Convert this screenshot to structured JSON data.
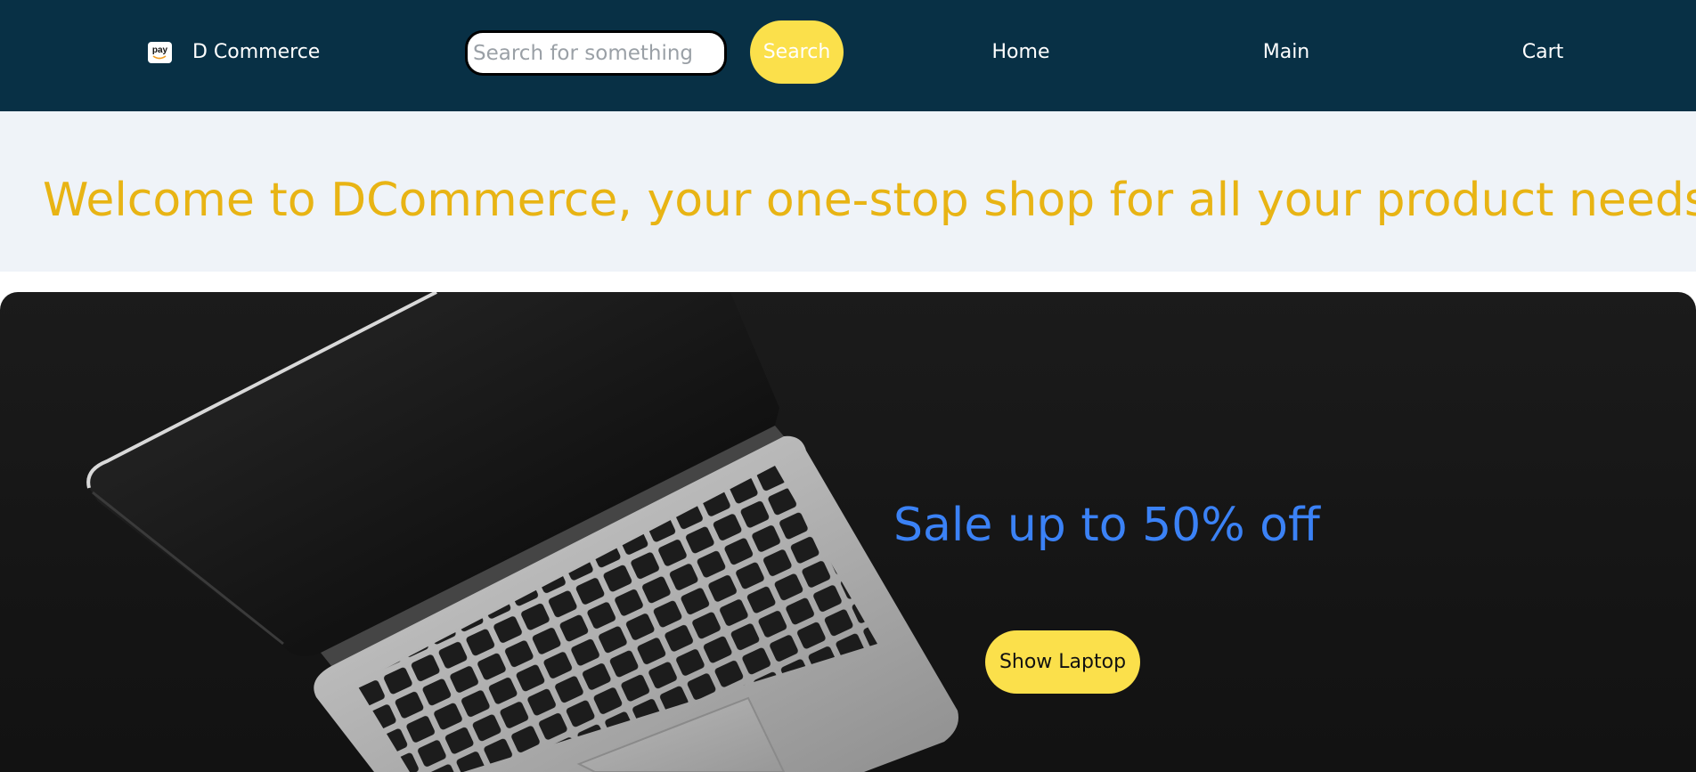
{
  "header": {
    "brand_name": "D Commerce",
    "brand_logo_text": "pay",
    "search": {
      "placeholder": "Search for something",
      "value": ""
    },
    "search_button_label": "Search",
    "nav_links": {
      "home": "Home",
      "main": "Main",
      "cart": "Cart"
    }
  },
  "welcome": {
    "heading": "Welcome to DCommerce, your one-stop shop for all your product needs!"
  },
  "hero": {
    "sale_text": "Sale up to 50% off",
    "button_label": "Show Laptop",
    "image_subject": "laptop"
  },
  "colors": {
    "header_bg": "#083045",
    "accent_yellow": "#fbe04b",
    "welcome_text": "#e8b414",
    "welcome_bg": "#eff3f8",
    "sale_text": "#3b82f6",
    "hero_bg": "#151515"
  },
  "icons": {
    "brand_logo": "amazon-pay-icon"
  }
}
